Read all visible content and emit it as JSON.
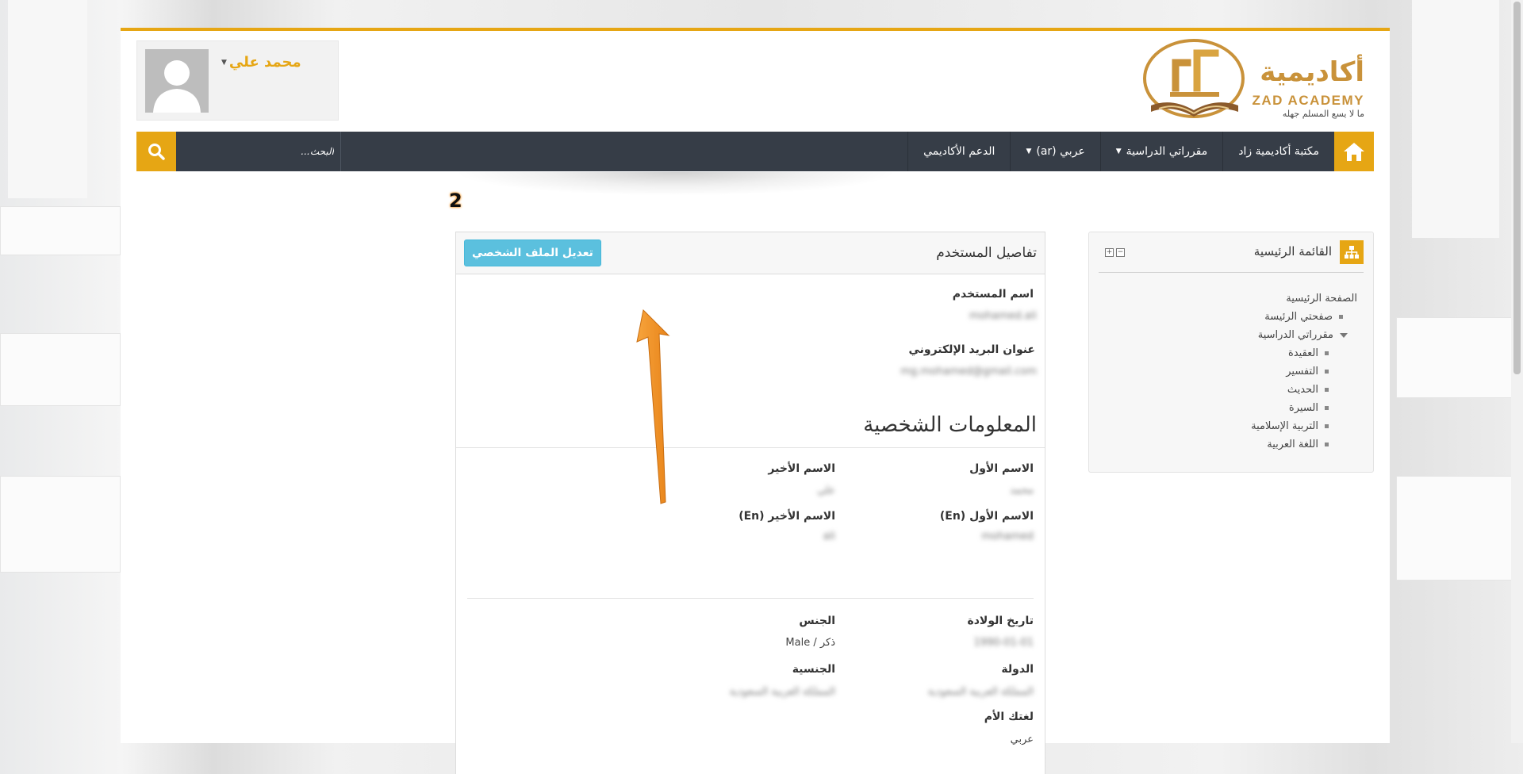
{
  "header": {
    "logo_title": "أكاديمية",
    "logo_subtitle": "ZAD ACADEMY",
    "logo_tagline": "ما لا يسع المسلم جهله",
    "user_name": "محمد علي"
  },
  "navbar": {
    "items": [
      {
        "label": "مكتبة أكاديمية زاد",
        "dropdown": false
      },
      {
        "label": "مقرراتي الدراسية",
        "dropdown": true
      },
      {
        "label": "عربي (ar)",
        "dropdown": true
      },
      {
        "label": "الدعم الأكاديمي",
        "dropdown": false
      }
    ],
    "search_placeholder": "البحث..."
  },
  "annotation": {
    "step_number": "2"
  },
  "nav_block": {
    "title": "القائمة الرئيسية",
    "items": [
      {
        "label": "الصفحة الرئيسية",
        "level": 0
      },
      {
        "label": "صفحتي الرئيسة",
        "level": 1
      },
      {
        "label": "مقرراتي الدراسية",
        "level": 1
      },
      {
        "label": "العقيدة",
        "level": 2
      },
      {
        "label": "التفسير",
        "level": 2
      },
      {
        "label": "الحديث",
        "level": 2
      },
      {
        "label": "السيرة",
        "level": 2
      },
      {
        "label": "التربية الإسلامية",
        "level": 2
      },
      {
        "label": "اللغة العربية",
        "level": 2
      }
    ]
  },
  "user_details": {
    "title": "تفاصيل المستخدم",
    "edit_button": "تعديل الملف الشخصي",
    "username_label": "اسم المستخدم",
    "username_value": "mohamed.ali",
    "email_label": "عنوان البريد الإلكتروني",
    "email_value": "mg.mohamed@gmail.com",
    "personal_info_title": "المعلومات الشخصية",
    "first_name_label": "الاسم الأول",
    "first_name_value": "محمد",
    "last_name_label": "الاسم الأخير",
    "last_name_value": "علي",
    "first_name_en_label": "الاسم الأول (En)",
    "first_name_en_value": "mohamed",
    "last_name_en_label": "الاسم الأخير (En)",
    "last_name_en_value": "ali",
    "birthdate_label": "تاريخ الولادة",
    "birthdate_value": "1990-01-01",
    "gender_label": "الجنس",
    "gender_value": "ذكر / Male",
    "country_label": "الدولة",
    "country_value": "المملكة العربية السعودية",
    "nationality_label": "الجنسية",
    "nationality_value": "المملكة العربية السعودية",
    "mother_tongue_label": "لغتك الأم",
    "mother_tongue_value": "عربي"
  },
  "colors": {
    "accent": "#e6a614",
    "navbar": "#363d47",
    "edit_button": "#5bc0de",
    "arrow": "#f59a2e"
  }
}
